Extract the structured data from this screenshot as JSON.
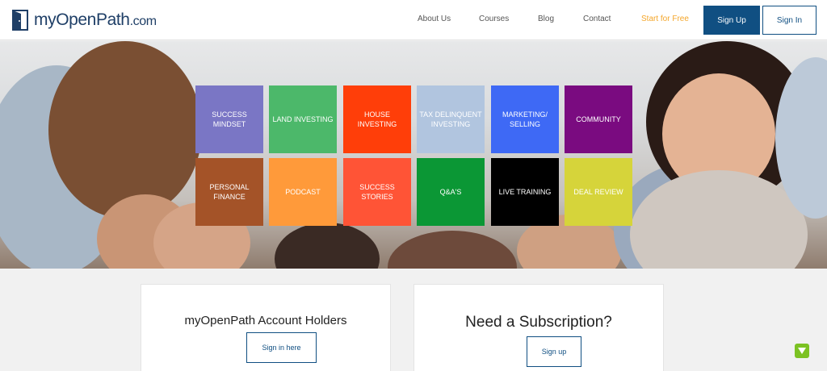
{
  "logo": {
    "brand": "myOpenPath",
    "domain": ".com"
  },
  "nav": {
    "links": [
      "About Us",
      "Courses",
      "Blog",
      "Contact"
    ],
    "cta": "Start for Free",
    "sign_up": "Sign Up",
    "sign_in": "Sign In"
  },
  "tiles": [
    {
      "label": "SUCCESS MINDSET",
      "color": "#7a76c5"
    },
    {
      "label": "LAND INVESTING",
      "color": "#4cb86a"
    },
    {
      "label": "HOUSE INVESTING",
      "color": "#ff3e09"
    },
    {
      "label": "TAX DELINQUENT INVESTING",
      "color": "#b1c5df"
    },
    {
      "label": "MARKETING/ SELLING",
      "color": "#3e69f5"
    },
    {
      "label": "COMMUNITY",
      "color": "#7a0b80"
    },
    {
      "label": "PERSONAL FINANCE",
      "color": "#a45328"
    },
    {
      "label": "PODCAST",
      "color": "#ff9a3a"
    },
    {
      "label": "SUCCESS STORIES",
      "color": "#ff5436"
    },
    {
      "label": "Q&A'S",
      "color": "#0b9735"
    },
    {
      "label": "LIVE TRAINING",
      "color": "#000000"
    },
    {
      "label": "DEAL REVIEW",
      "color": "#d6d43a"
    }
  ],
  "cards": {
    "account_holders": {
      "title": "myOpenPath Account Holders",
      "button": "Sign in here"
    },
    "subscription": {
      "title": "Need a Subscription?",
      "button": "Sign up"
    }
  },
  "colors": {
    "brand": "#104f82",
    "cta": "#f4a62a",
    "accent_green": "#7cc223"
  }
}
